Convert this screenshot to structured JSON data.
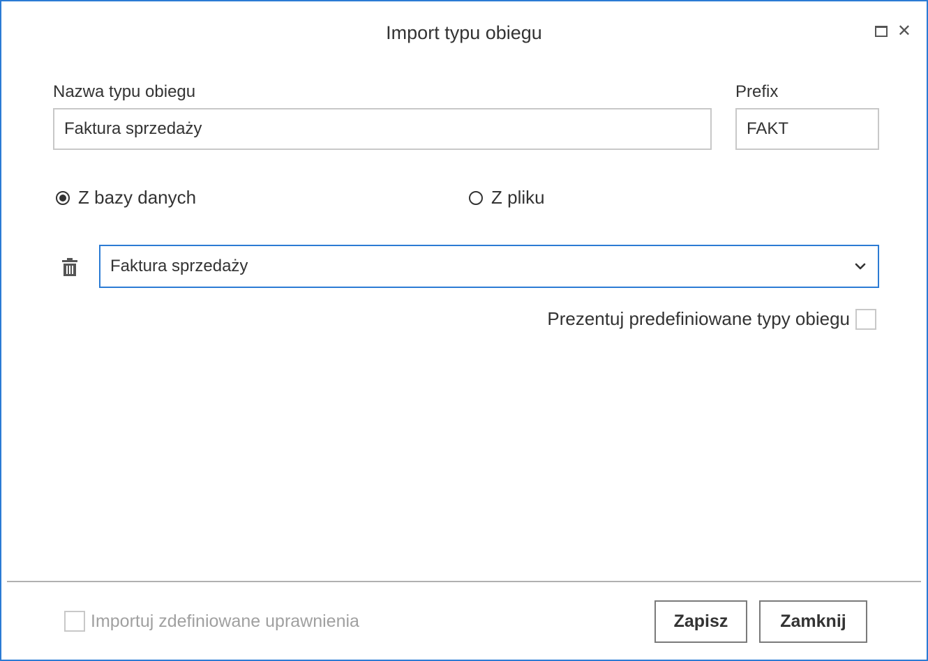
{
  "window": {
    "title": "Import typu obiegu",
    "accent_color": "#2b7bd4"
  },
  "form": {
    "name_label": "Nazwa typu obiegu",
    "name_value": "Faktura sprzedaży",
    "prefix_label": "Prefix",
    "prefix_value": "FAKT"
  },
  "source": {
    "options": [
      {
        "label": "Z bazy danych",
        "selected": true
      },
      {
        "label": "Z pliku",
        "selected": false
      }
    ]
  },
  "dropdown": {
    "selected": "Faktura sprzedaży",
    "icon": "chevron-down-icon"
  },
  "predefined": {
    "label": "Prezentuj predefiniowane typy obiegu",
    "checked": false
  },
  "footer": {
    "import_permissions_label": "Importuj zdefiniowane uprawnienia",
    "import_permissions_checked": false,
    "save_label": "Zapisz",
    "close_label": "Zamknij"
  }
}
